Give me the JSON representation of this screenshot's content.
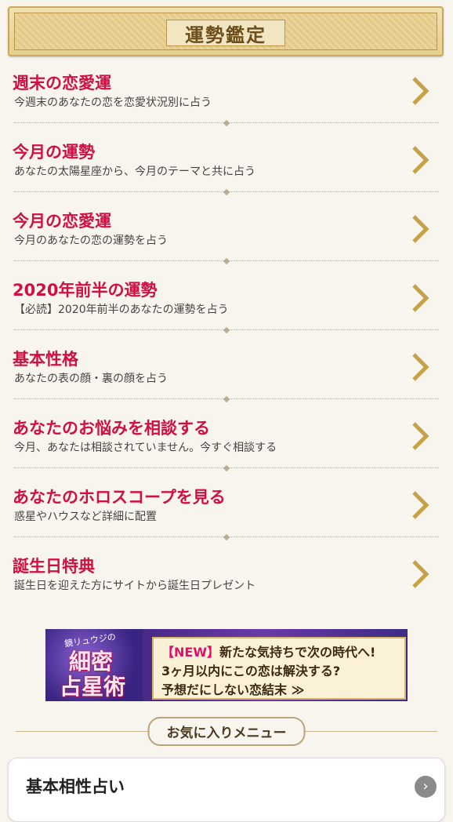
{
  "header": {
    "title": "運勢鑑定"
  },
  "menu": [
    {
      "title": "週末の恋愛運",
      "subtitle": "今週末のあなたの恋を恋愛状況別に占う"
    },
    {
      "title": "今月の運勢",
      "subtitle": "あなたの太陽星座から、今月のテーマと共に占う"
    },
    {
      "title": "今月の恋愛運",
      "subtitle": "今月のあなたの恋の運勢を占う"
    },
    {
      "title": "2020年前半の運勢",
      "subtitle": "【必読】2020年前半のあなたの運勢を占う"
    },
    {
      "title": "基本性格",
      "subtitle": "あなたの表の顔・裏の顔を占う"
    },
    {
      "title": "あなたのお悩みを相談する",
      "subtitle": "今月、あなたは相談されていません。今すぐ相談する"
    },
    {
      "title": "あなたのホロスコープを見る",
      "subtitle": "惑星やハウスなど詳細に配置"
    },
    {
      "title": "誕生日特典",
      "subtitle": "誕生日を迎えた方にサイトから誕生日プレゼント"
    }
  ],
  "banner": {
    "author": "鏡リュウジの",
    "logo_line1": "細密",
    "logo_line2": "占星術",
    "badge": "【NEW】",
    "line1": "新たな気持ちで次の時代へ!",
    "line2": "3ヶ月以内にこの恋は解決する?",
    "line3": "予想だにしない恋結末 ≫"
  },
  "favorites": {
    "label": "お気に入りメニュー"
  },
  "card": {
    "title": "基本相性占い",
    "arrow": "›"
  },
  "colors": {
    "accent": "#d01040",
    "chevron": "#c8a24a",
    "background": "#f8f5ee"
  }
}
